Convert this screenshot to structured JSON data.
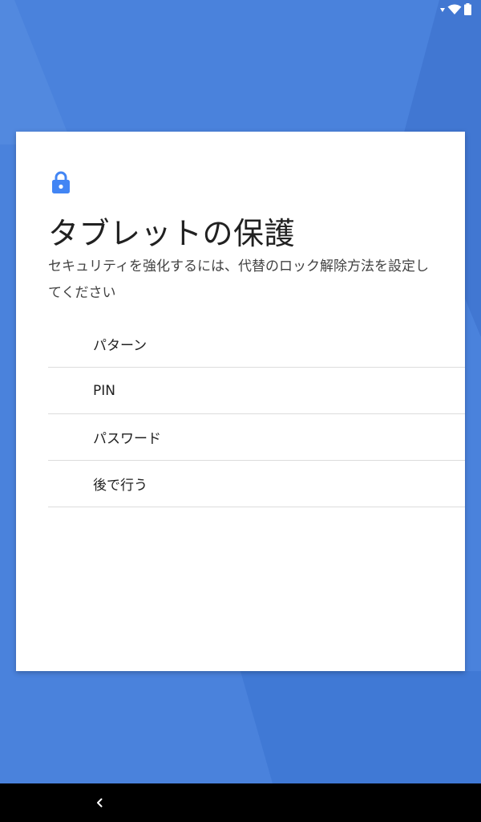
{
  "setup": {
    "title": "タブレットの保護",
    "description": "セキュリティを強化するには、代替のロック解除方法を設定してください",
    "options": [
      {
        "label": "パターン"
      },
      {
        "label": "PIN"
      },
      {
        "label": "パスワード"
      },
      {
        "label": "後で行う"
      }
    ]
  },
  "icons": {
    "lock": "lock-icon",
    "wifi": "wifi-icon",
    "battery": "battery-icon",
    "signal": "signal-indicator-icon",
    "back": "back-icon"
  },
  "colors": {
    "background": "#4a82dc",
    "accent": "#4285f4",
    "card": "#ffffff",
    "nav_bar": "#000000"
  }
}
